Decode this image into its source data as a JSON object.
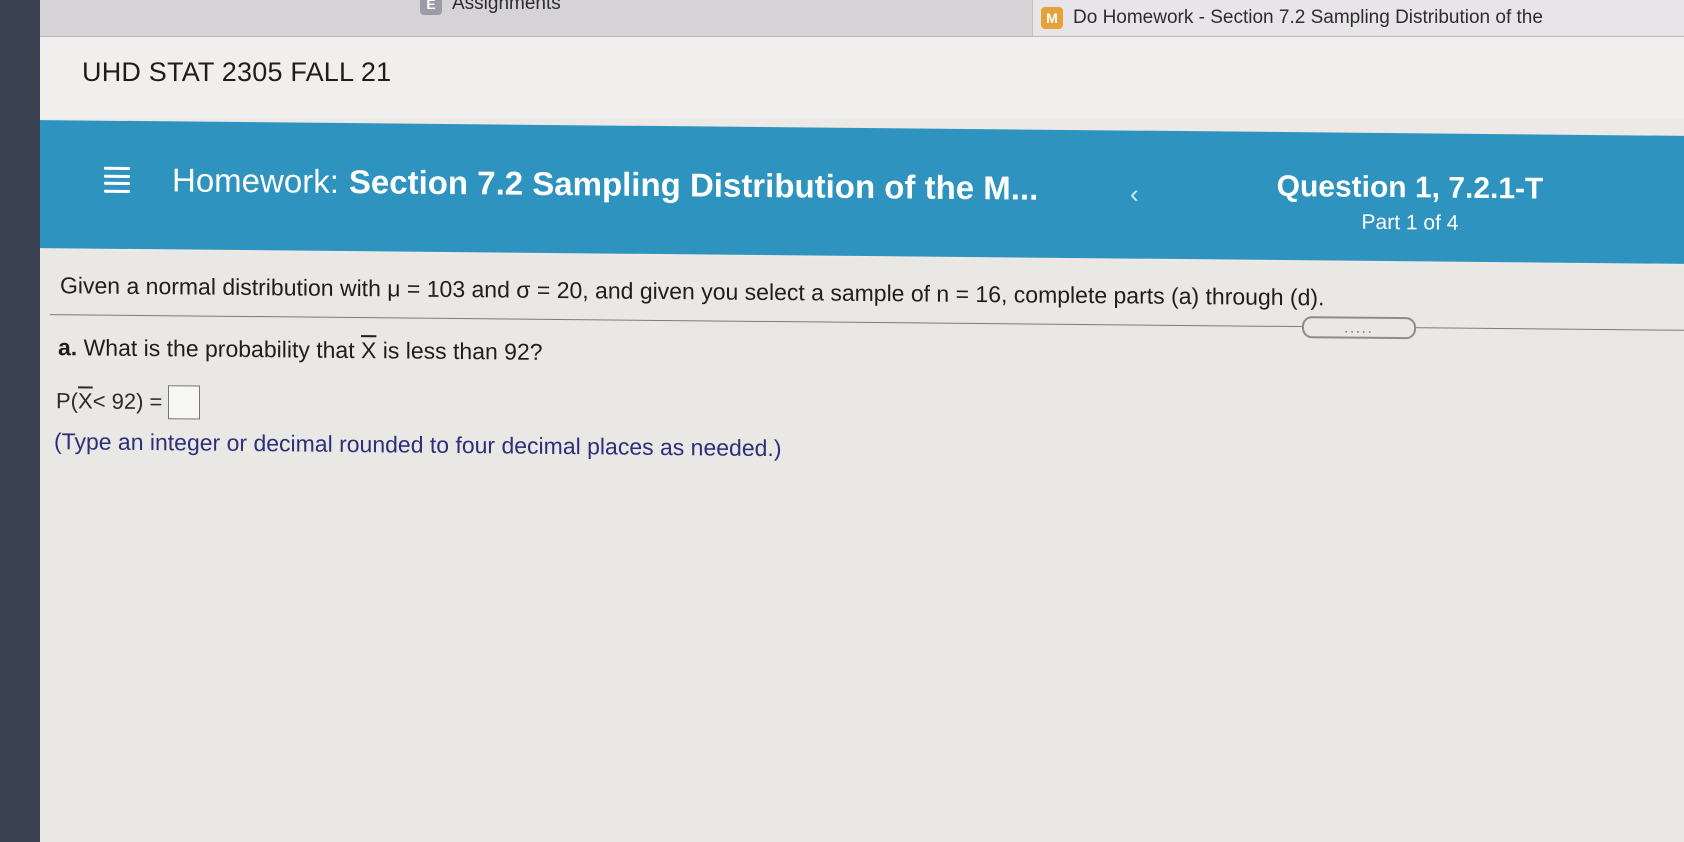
{
  "browser": {
    "tabs": [
      {
        "favicon": "E",
        "label": "Assignments"
      },
      {
        "favicon": "M",
        "label": "Do Homework - Section 7.2 Sampling Distribution of the"
      }
    ]
  },
  "course": {
    "title": "UHD STAT 2305 FALL 21"
  },
  "banner": {
    "prefix": "Homework:",
    "title": "Section 7.2 Sampling Distribution of the M...",
    "prev_icon": "‹",
    "question": "Question 1, 7.2.1-T",
    "part": "Part 1 of 4"
  },
  "problem": {
    "intro_a": "Given a normal distribution with ",
    "mu_sym": "μ",
    "eq1": " = 103 and ",
    "sigma_sym": "σ",
    "eq2": " = 20, and given you select a sample of n = 16, complete parts (a) through (d).",
    "expand_label": "....."
  },
  "question_a": {
    "label": "a.",
    "text_1": " What is the probability that ",
    "xbar": "X",
    "text_2": " is less than 92?",
    "answer_prefix_1": "P(",
    "answer_prefix_2": "X",
    "answer_prefix_3": " < 92) =",
    "answer_value": "",
    "hint": "(Type an integer or decimal rounded to four decimal places as needed.)"
  }
}
